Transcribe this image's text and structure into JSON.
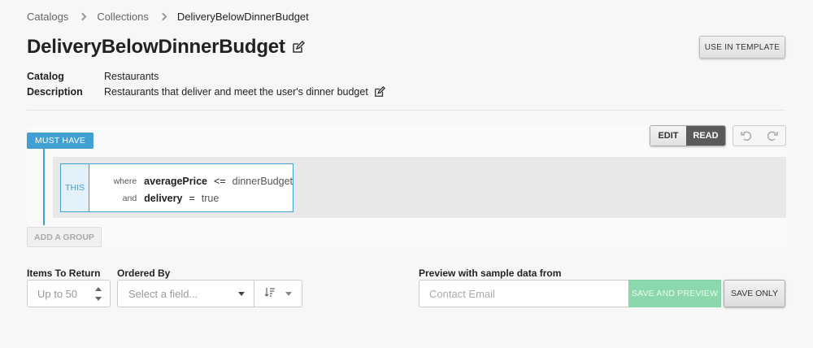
{
  "breadcrumb": {
    "items": [
      {
        "label": "Catalogs"
      },
      {
        "label": "Collections"
      },
      {
        "label": "DeliveryBelowDinnerBudget"
      }
    ]
  },
  "header": {
    "title": "DeliveryBelowDinnerBudget",
    "use_in_template_label": "USE IN TEMPLATE"
  },
  "meta": {
    "catalog_label": "Catalog",
    "catalog_value": "Restaurants",
    "description_label": "Description",
    "description_value": "Restaurants that deliver and meet the user's dinner budget"
  },
  "rules": {
    "group_label": "MUST HAVE",
    "mode_edit": "EDIT",
    "mode_read": "READ",
    "mode_active": "READ",
    "this_label": "THIS",
    "clauses": [
      {
        "keyword": "where",
        "field": "averagePrice",
        "operator": "<=",
        "value": "dinnerBudget"
      },
      {
        "keyword": "and",
        "field": "delivery",
        "operator": "=",
        "value": "true"
      }
    ],
    "add_group_label": "ADD A GROUP"
  },
  "output": {
    "items_label": "Items To Return",
    "items_placeholder": "Up to 50",
    "ordered_by_label": "Ordered By",
    "ordered_by_placeholder": "Select a field...",
    "preview_label": "Preview with sample data from",
    "contact_placeholder": "Contact Email",
    "save_preview_label": "SAVE AND PREVIEW",
    "save_only_label": "SAVE ONLY"
  },
  "colors": {
    "accent": "#41a0d2",
    "save_preview_bg": "#8ad8ab",
    "read_active_bg": "#5a5a5a"
  },
  "icons": {
    "edit": "pencil-square-icon",
    "undo": "undo-icon",
    "redo": "redo-icon",
    "sort": "sort-icon"
  }
}
